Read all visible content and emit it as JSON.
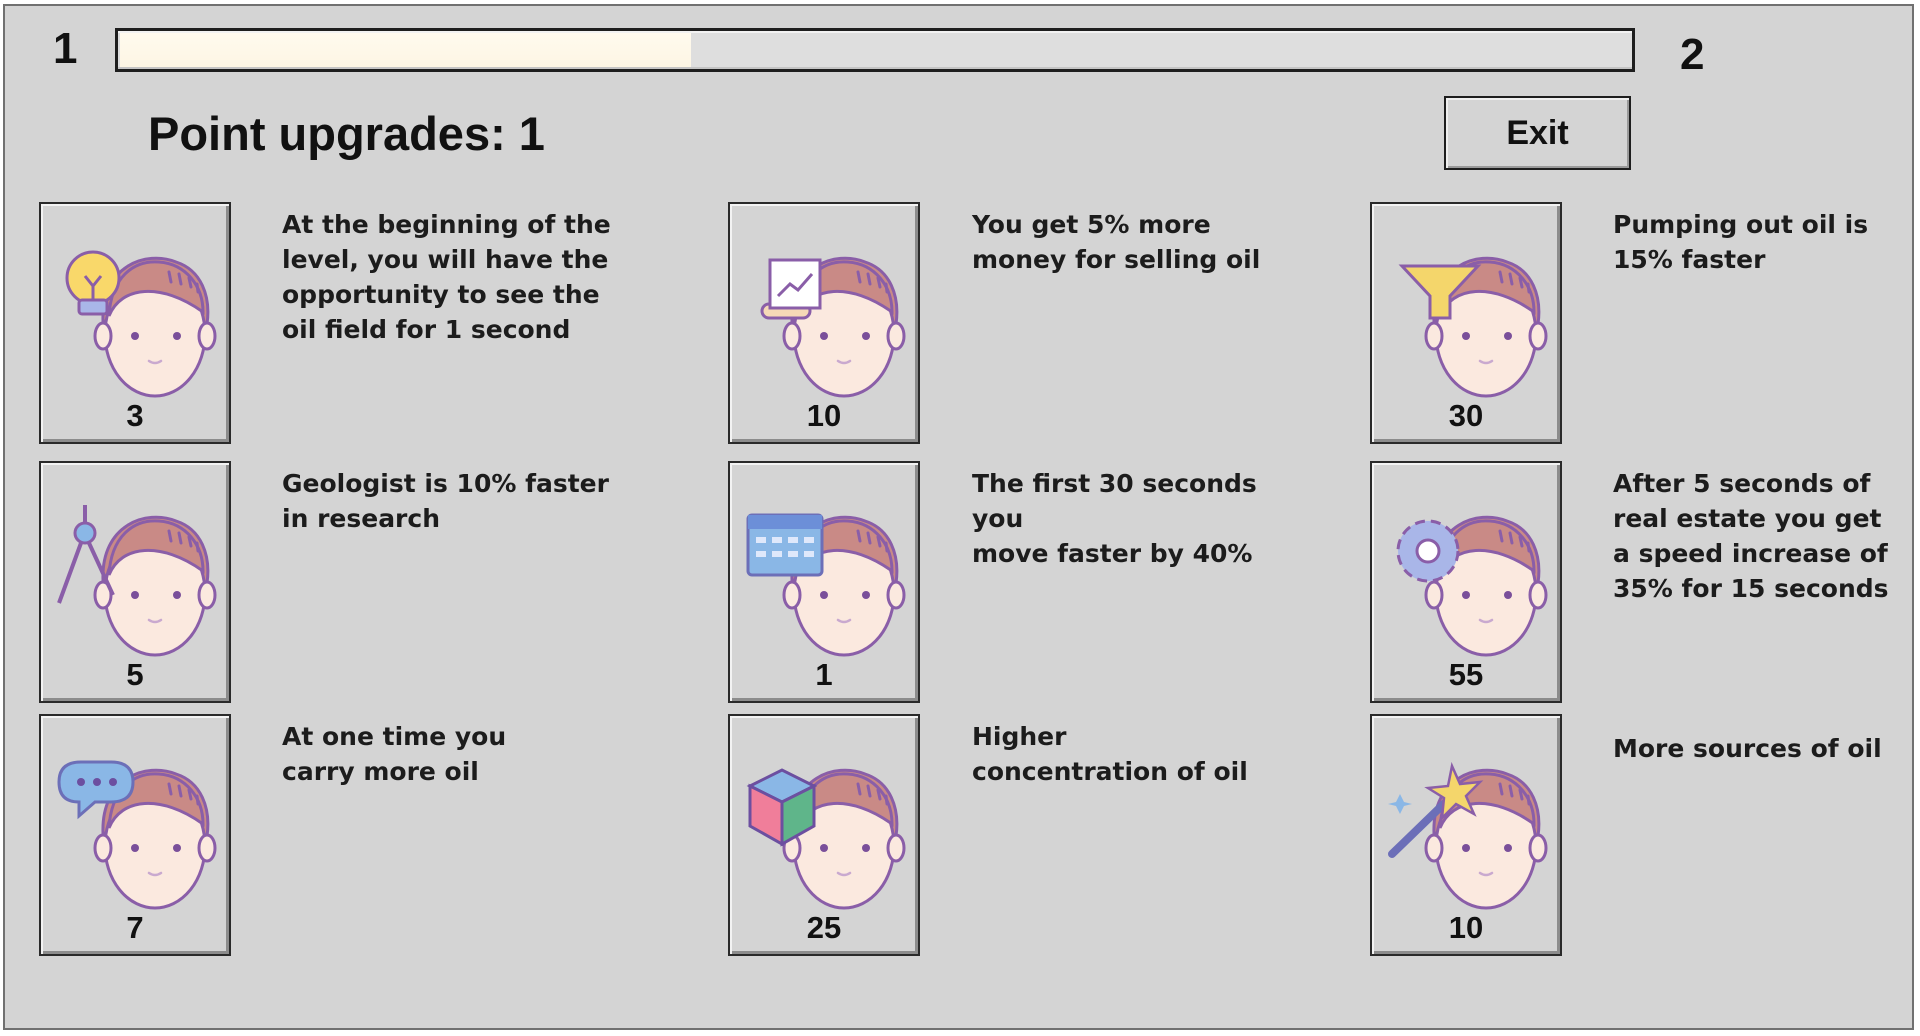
{
  "level": {
    "current": "1",
    "next": "2",
    "progress": 0.38
  },
  "title": "Point upgrades: 1",
  "exit_label": "Exit",
  "upgrades": [
    {
      "cost": "3",
      "icon": "lightbulb-icon",
      "text_lines": [
        "At the beginning of the",
        "level, you will have the",
        "opportunity to see the",
        "oil field for 1 second"
      ]
    },
    {
      "cost": "10",
      "icon": "chart-presentation-icon",
      "text_lines": [
        "You get 5% more",
        "money for selling oil"
      ]
    },
    {
      "cost": "30",
      "icon": "funnel-icon",
      "text_lines": [
        "Pumping out oil is",
        "15% faster"
      ]
    },
    {
      "cost": "5",
      "icon": "compass-icon",
      "text_lines": [
        "Geologist is 10% faster",
        "in research"
      ]
    },
    {
      "cost": "1",
      "icon": "calendar-icon",
      "text_lines": [
        "The first 30 seconds you",
        "move faster by 40%"
      ]
    },
    {
      "cost": "55",
      "icon": "gear-icon",
      "text_lines": [
        "After 5 seconds of",
        "real estate you get",
        "a speed increase of",
        "35% for 15 seconds"
      ]
    },
    {
      "cost": "7",
      "icon": "speech-bubble-icon",
      "text_lines": [
        "At one time you",
        "carry more oil"
      ]
    },
    {
      "cost": "25",
      "icon": "cube-icon",
      "text_lines": [
        "Higher",
        "concentration of oil"
      ]
    },
    {
      "cost": "10",
      "icon": "magic-wand-icon",
      "text_lines": [
        "More sources of oil"
      ]
    }
  ]
}
